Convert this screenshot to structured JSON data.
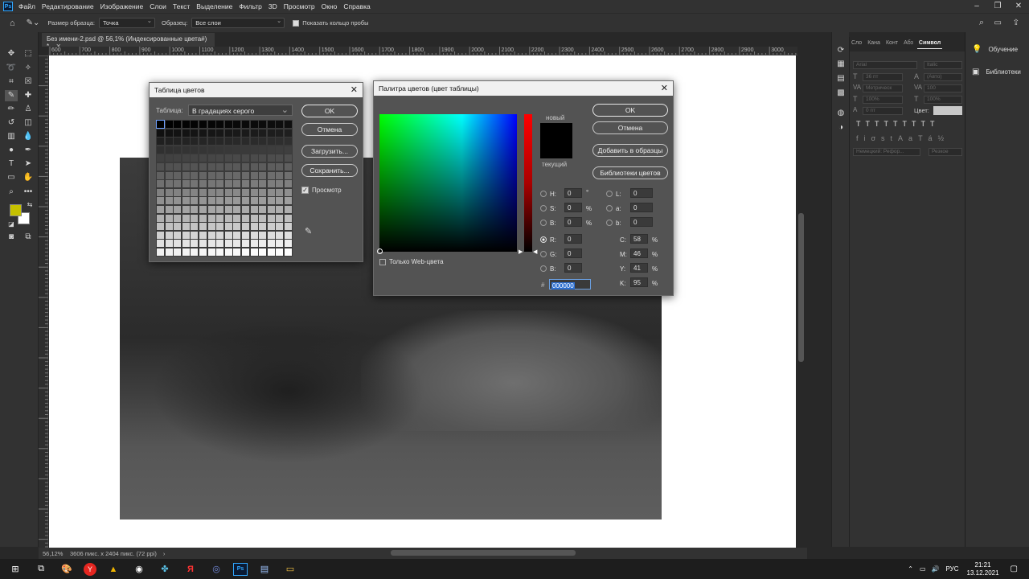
{
  "menu": {
    "logo": "Ps",
    "items": [
      "Файл",
      "Редактирование",
      "Изображение",
      "Слои",
      "Текст",
      "Выделение",
      "Фильтр",
      "3D",
      "Просмотр",
      "Окно",
      "Справка"
    ]
  },
  "options": {
    "sample_size_label": "Размер образца:",
    "sample_size_value": "Точка",
    "sample_label": "Образец:",
    "sample_value": "Все слои",
    "show_ring_label": "Показать кольцо пробы"
  },
  "document": {
    "tab_title": "Без имени-2.psd @ 56,1% (Индексированные цвета#) *",
    "ruler_ticks": [
      "600",
      "700",
      "800",
      "900",
      "1000",
      "1100",
      "1200",
      "1300",
      "1400",
      "1500",
      "1600",
      "1700",
      "1800",
      "1900",
      "2000",
      "2100",
      "2200",
      "2300",
      "2400",
      "2500",
      "2600",
      "2700",
      "2800",
      "2900",
      "3000"
    ],
    "zoom": "56,12%",
    "size_info": "3606 пикс. x 2404 пикс. (72 ppi)"
  },
  "color_table_dialog": {
    "title": "Таблица цветов",
    "table_label": "Таблица:",
    "table_value": "В градациях серого",
    "ok": "OK",
    "cancel": "Отмена",
    "load": "Загрузить...",
    "save": "Сохранить...",
    "preview": "Просмотр"
  },
  "color_picker_dialog": {
    "title": "Палитра цветов (цвет таблицы)",
    "ok": "OK",
    "cancel": "Отмена",
    "add_to_swatches": "Добавить в образцы",
    "color_libraries": "Библиотеки цветов",
    "new_label": "новый",
    "current_label": "текущий",
    "web_only": "Только Web-цвета",
    "H": "0",
    "S": "0",
    "B": "0",
    "R": "0",
    "G": "0",
    "Bv": "0",
    "L": "0",
    "a": "0",
    "b": "0",
    "C": "58",
    "M": "46",
    "Y": "41",
    "K": "95",
    "hex": "000000",
    "deg": "°",
    "pct": "%",
    "hash": "#"
  },
  "labels": {
    "H": "H:",
    "S": "S:",
    "B": "B:",
    "R": "R:",
    "G": "G:",
    "Bb": "B:",
    "L": "L:",
    "a": "a:",
    "b": "b:",
    "C": "C:",
    "M": "M:",
    "Y": "Y:",
    "K": "K:"
  },
  "char_panel": {
    "tabs": [
      "Сло",
      "Кана",
      "Конт",
      "Абз",
      "Символ"
    ],
    "font": "Arial",
    "style": "Italic",
    "size": "36 пт",
    "leading": "(Авто)",
    "kerning": "Метрическ",
    "tracking": "100",
    "vscale": "100%",
    "hscale": "100%",
    "baseline": "0 пт",
    "color_label": "Цвет:",
    "lang": "Немецкий: Рефор...",
    "aa": "Резкое"
  },
  "learn_panel": {
    "learn": "Обучение",
    "libraries": "Библиотеки"
  },
  "taskbar": {
    "lang": "РУС",
    "time": "21:21",
    "date": "13.12.2021"
  },
  "colors": {
    "foreground": "#c5c100",
    "background": "#ffffff",
    "accent": "#31a8ff"
  }
}
